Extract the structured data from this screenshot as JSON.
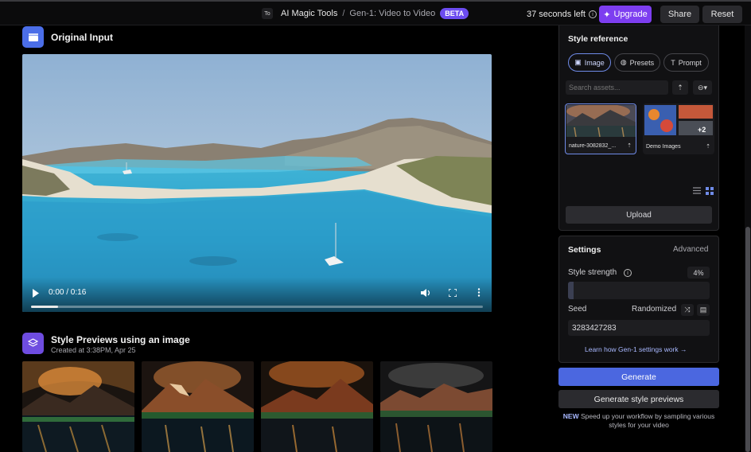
{
  "header": {
    "workspace_initials": "To",
    "breadcrumb_root": "AI Magic Tools",
    "breadcrumb_sep": "/",
    "breadcrumb_leaf": "Gen-1: Video to Video",
    "badge": "BETA",
    "time_left": "37 seconds left",
    "upgrade_label": "Upgrade",
    "share_label": "Share",
    "reset_label": "Reset"
  },
  "original": {
    "title": "Original Input",
    "video": {
      "time": "0:00 / 0:16",
      "progress_fraction": 0.06
    }
  },
  "previews": {
    "title": "Style Previews using an image",
    "subtitle": "Created at 3:38PM, Apr 25"
  },
  "style_reference": {
    "title": "Style reference",
    "tabs": [
      {
        "label": "Image",
        "active": true
      },
      {
        "label": "Presets",
        "active": false
      },
      {
        "label": "Prompt",
        "active": false
      }
    ],
    "search_placeholder": "Search assets...",
    "assets": [
      {
        "caption": "nature-3082832_...",
        "selected": true
      },
      {
        "caption": "Demo Images",
        "extra_count": "+2",
        "selected": false
      }
    ],
    "upload_label": "Upload"
  },
  "settings": {
    "title": "Settings",
    "advanced_label": "Advanced",
    "style_strength_label": "Style strength",
    "style_strength_value": "4%",
    "seed_label": "Seed",
    "seed_mode": "Randomized",
    "seed_value": "3283427283",
    "learn_link": "Learn how Gen-1 settings work"
  },
  "actions": {
    "generate_label": "Generate",
    "previews_label": "Generate style previews",
    "note_new": "NEW",
    "note_text": " Speed up your workflow by sampling various styles for your video"
  },
  "colors": {
    "accent_purple": "#7d3ef0",
    "accent_blue": "#4b67e0",
    "section_icon_blue": "#4b6ee8",
    "section_icon_purple": "#6e4ce0"
  }
}
